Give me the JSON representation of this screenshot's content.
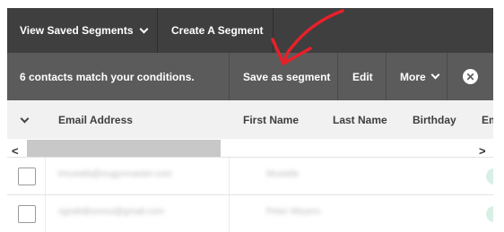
{
  "topnav": {
    "view_saved": "View Saved Segments",
    "create": "Create A Segment"
  },
  "actionbar": {
    "match_text": "6 contacts match your conditions.",
    "save_segment": "Save as segment",
    "edit": "Edit",
    "more": "More",
    "close_glyph": "✕"
  },
  "table": {
    "columns": [
      "Email Address",
      "First Name",
      "Last Name",
      "Birthday",
      "Em"
    ],
    "scroll_left": "<",
    "scroll_right": ">",
    "rows": [
      {
        "email": "lmustafa@eugymnaster.com",
        "first_name": "Mustafa"
      },
      {
        "email": "ogndeljhonnui@gmail.com",
        "first_name": "Peter Weyers"
      }
    ]
  },
  "colors": {
    "topnav_bg": "#3f3f3f",
    "actionbar_bg": "#5b5b5b",
    "annotation_arrow": "#e8202a"
  }
}
